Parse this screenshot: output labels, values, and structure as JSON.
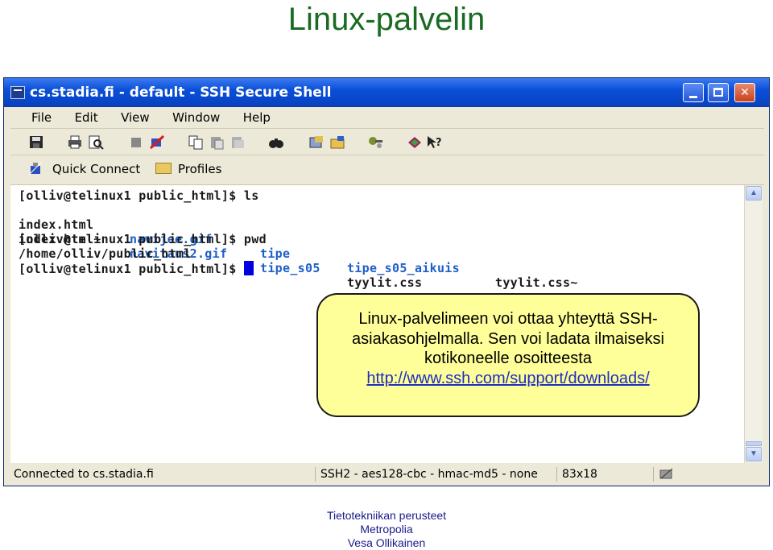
{
  "slide": {
    "title": "Linux-palvelin"
  },
  "window": {
    "title": "cs.stadia.fi - default - SSH Secure Shell",
    "menu": [
      "File",
      "Edit",
      "View",
      "Window",
      "Help"
    ],
    "quick_connect": "Quick Connect",
    "profiles": "Profiles"
  },
  "terminal": {
    "prompt1": "[olliv@telinux1 public_html]$ ls",
    "ls_row1": [
      "index.html",
      "navijee.gif",
      "tipe",
      "tipe_s05_aikuis",
      "tyylit.css~"
    ],
    "ls_row2": [
      "index.html~",
      "navitaus2.gif",
      "tipe_s05",
      "tyylit.css"
    ],
    "prompt2": "[olliv@telinux1 public_html]$ pwd",
    "pwd_output": "/home/olliv/public_html",
    "prompt3": "[olliv@telinux1 public_html]$ "
  },
  "status": {
    "connection": "Connected to cs.stadia.fi",
    "cipher": "SSH2 - aes128-cbc - hmac-md5 - none",
    "size": "83x18"
  },
  "callout": {
    "text": "Linux-palvelimeen voi ottaa yhteyttä SSH-asiakasohjelmalla. Sen voi ladata ilmaiseksi kotikoneelle osoitteesta",
    "link": "http://www.ssh.com/support/downloads/"
  },
  "footer": {
    "line1": "Tietotekniikan perusteet",
    "line2": "Metropolia",
    "line3": "Vesa Ollikainen"
  },
  "colors": {
    "title_green": "#1a6b22",
    "titlebar_blue": "#0a4fd9",
    "link_blue": "#1f5fc8",
    "callout_yellow": "#ffff99"
  }
}
